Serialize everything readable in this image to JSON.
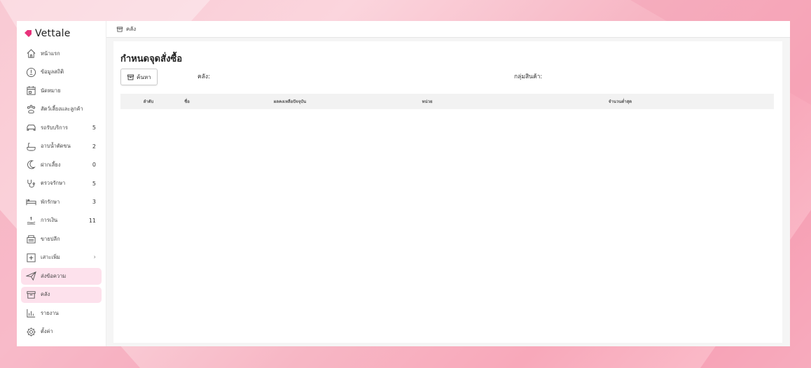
{
  "app": {
    "brand": "Vettale",
    "brand_color": "#e8317a"
  },
  "breadcrumb": {
    "label": "คลัง"
  },
  "sidebar": {
    "items": [
      {
        "label": "หน้าแรก",
        "icon": "home-icon",
        "badge": ""
      },
      {
        "label": "ข้อมูลสถิติ",
        "icon": "info-icon",
        "badge": ""
      },
      {
        "label": "นัดหมาย",
        "icon": "calendar-icon",
        "badge": ""
      },
      {
        "label": "สัตว์เลี้ยงและลูกค้า",
        "icon": "paw-icon",
        "badge": ""
      },
      {
        "label": "รถรับบริการ",
        "icon": "car-icon",
        "badge": "5"
      },
      {
        "label": "อาบน้ำตัดขน",
        "icon": "bathtub-icon",
        "badge": "2"
      },
      {
        "label": "ฝากเลี้ยง",
        "icon": "moon-icon",
        "badge": "0"
      },
      {
        "label": "ตรวจรักษา",
        "icon": "stethoscope-icon",
        "badge": "5"
      },
      {
        "label": "พักรักษา",
        "icon": "bed-icon",
        "badge": "3"
      },
      {
        "label": "การเงิน",
        "icon": "payment-icon",
        "badge": "11"
      },
      {
        "label": "ขายปลีก",
        "icon": "cash-register-icon",
        "badge": ""
      },
      {
        "label": "เสาะเพิ่ม",
        "icon": "plus-square-icon",
        "badge": ""
      },
      {
        "label": "ส่งข้อความ",
        "icon": "send-icon",
        "badge": ""
      },
      {
        "label": "คลัง",
        "icon": "archive-icon",
        "badge": ""
      },
      {
        "label": "รายงาน",
        "icon": "bar-chart-icon",
        "badge": ""
      },
      {
        "label": "ตั้งค่า",
        "icon": "gear-icon",
        "badge": ""
      }
    ]
  },
  "page": {
    "title": "กำหนดจุดสั่งซื้อ",
    "search_label": "ค้นหา",
    "filter_warehouse_label": "คลัง:",
    "filter_group_label": "กลุ่มสินค้า:"
  },
  "table": {
    "headers": [
      "ลำดับ",
      "ชื่อ",
      "ผลคงเหลือปัจจุบัน",
      "หน่วย",
      "จำนวนต่ำสุด"
    ],
    "rows": []
  }
}
